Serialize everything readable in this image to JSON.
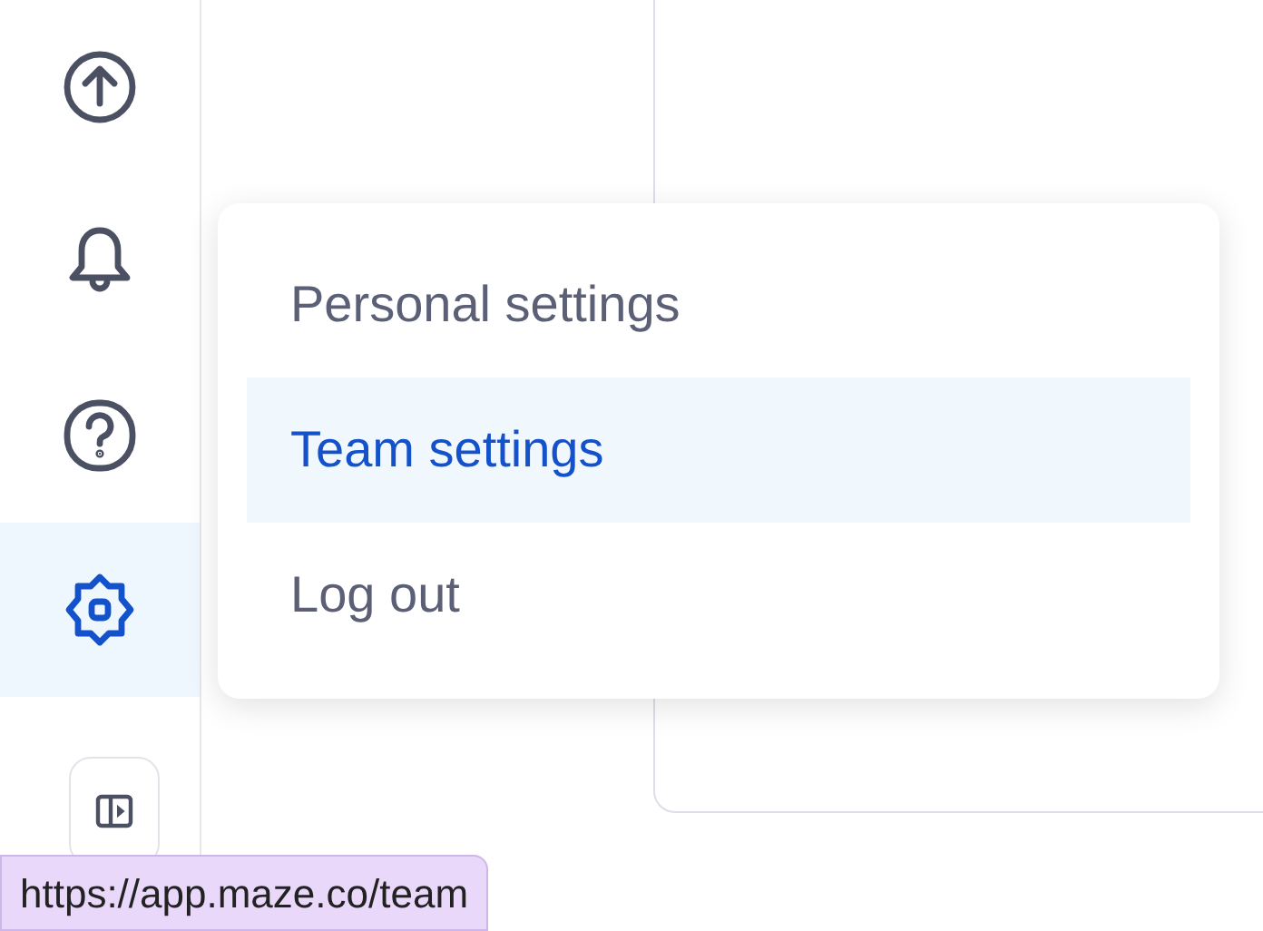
{
  "sidebar": {
    "items": [
      {
        "kind": "upload",
        "selected": false
      },
      {
        "kind": "bell",
        "selected": false
      },
      {
        "kind": "help",
        "selected": false
      },
      {
        "kind": "settings",
        "selected": true
      }
    ]
  },
  "menu": {
    "items": [
      {
        "label": "Personal settings",
        "selected": false
      },
      {
        "label": "Team settings",
        "selected": true
      },
      {
        "label": "Log out",
        "selected": false
      }
    ]
  },
  "status_bar": {
    "url": "https://app.maze.co/team"
  }
}
